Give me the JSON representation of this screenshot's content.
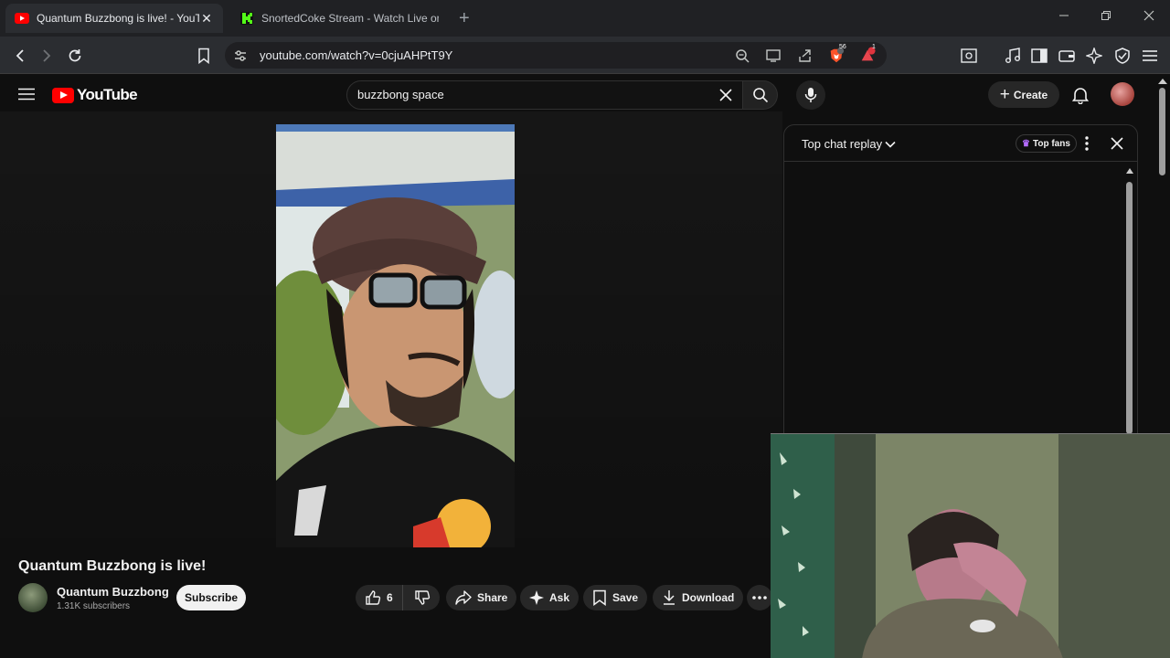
{
  "browser": {
    "tabs": [
      {
        "title": "Quantum Buzzbong is live! - YouTube",
        "active": true
      },
      {
        "title": "SnortedCoke Stream - Watch Live on Kick",
        "active": false
      }
    ],
    "url": "youtube.com/watch?v=0cjuAHPtT9Y",
    "shield_badge": "56",
    "alert_badge": "1"
  },
  "youtube": {
    "logo_text": "YouTube",
    "search": {
      "value": "buzzbong space",
      "placeholder": "Search"
    },
    "create_label": "Create",
    "chat": {
      "title": "Top chat replay",
      "top_fans_label": "Top fans"
    },
    "video": {
      "title": "Quantum Buzzbong is live!",
      "channel_name": "Quantum Buzzbong",
      "subscribers": "1.31K subscribers",
      "subscribe_label": "Subscribe",
      "like_count": "6",
      "share_label": "Share",
      "ask_label": "Ask",
      "save_label": "Save",
      "download_label": "Download"
    }
  },
  "colors": {
    "yt_red": "#ff0000",
    "background": "#0f0f0f",
    "kick_green": "#53fc18"
  }
}
